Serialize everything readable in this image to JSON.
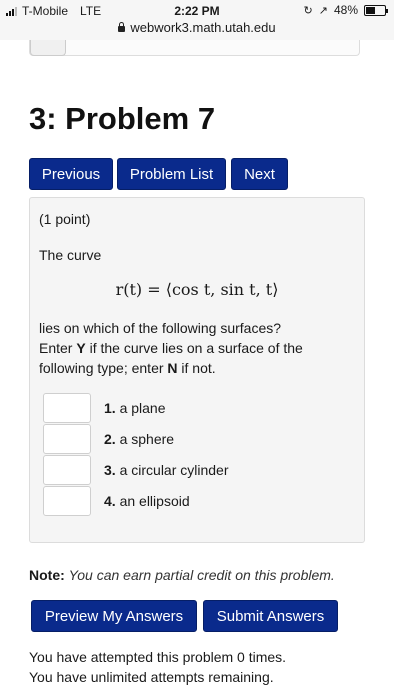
{
  "status_bar": {
    "carrier": "T-Mobile",
    "network": "LTE",
    "time": "2:22 PM",
    "battery_percent": "48%",
    "battery_level": 0.48
  },
  "browser": {
    "url": "webwork3.math.utah.edu"
  },
  "page": {
    "title": "3: Problem 7"
  },
  "nav": {
    "previous": "Previous",
    "problem_list": "Problem List",
    "next": "Next"
  },
  "problem": {
    "points": "(1 point)",
    "intro": "The curve",
    "formula": {
      "lhs": "r(t) = ",
      "rhs": "⟨cos t, sin t, t⟩"
    },
    "question_line1": "lies on which of the following surfaces?",
    "instruction": {
      "enter": "Enter ",
      "y": "Y",
      "if_curve": " if the curve lies on a surface of the following type; enter ",
      "n": "N",
      "if_not": " if not."
    },
    "answers": [
      {
        "number": "1.",
        "label": "a plane",
        "value": ""
      },
      {
        "number": "2.",
        "label": "a sphere",
        "value": ""
      },
      {
        "number": "3.",
        "label": "a circular cylinder",
        "value": ""
      },
      {
        "number": "4.",
        "label": "an ellipsoid",
        "value": ""
      }
    ]
  },
  "note": {
    "label": "Note:",
    "text": "You can earn partial credit on this problem."
  },
  "actions": {
    "preview": "Preview My Answers",
    "submit": "Submit Answers"
  },
  "attempts": {
    "line1": "You have attempted this problem 0 times.",
    "line2": "You have unlimited attempts remaining."
  }
}
